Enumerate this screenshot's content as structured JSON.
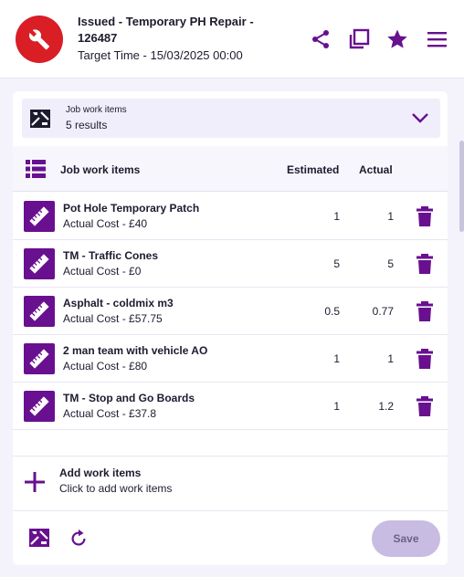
{
  "header": {
    "title": "Issued - Temporary PH Repair - 126487",
    "target_time": "Target Time - 15/03/2025 00:00",
    "avatar_icon": "wrench-icon",
    "actions": [
      "share-icon",
      "copy-icon",
      "star-icon",
      "menu-icon"
    ]
  },
  "summary": {
    "label": "Job work items",
    "count": "5 results"
  },
  "table": {
    "heading": "Job work items",
    "col_estimated": "Estimated",
    "col_actual": "Actual",
    "rows": [
      {
        "name": "Pot Hole Temporary Patch",
        "cost": "Actual Cost - £40",
        "estimated": "1",
        "actual": "1"
      },
      {
        "name": "TM - Traffic Cones",
        "cost": "Actual Cost - £0",
        "estimated": "5",
        "actual": "5"
      },
      {
        "name": "Asphalt - coldmix m3",
        "cost": "Actual Cost - £57.75",
        "estimated": "0.5",
        "actual": "0.77"
      },
      {
        "name": "2 man team with vehicle AO",
        "cost": "Actual Cost - £80",
        "estimated": "1",
        "actual": "1"
      },
      {
        "name": "TM - Stop and Go Boards",
        "cost": "Actual Cost - £37.8",
        "estimated": "1",
        "actual": "1.2"
      }
    ]
  },
  "add": {
    "title": "Add work items",
    "subtitle": "Click to add work items"
  },
  "footer": {
    "save_label": "Save"
  },
  "colors": {
    "accent": "#68108f",
    "avatar": "#d91e26",
    "save_disabled": "#c8bce2"
  }
}
